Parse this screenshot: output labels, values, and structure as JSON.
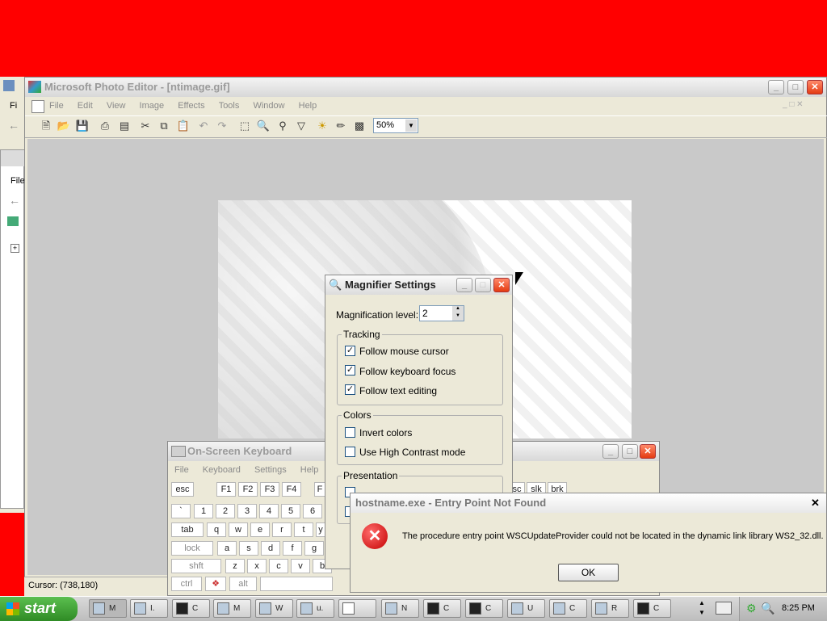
{
  "photo_editor": {
    "title": "Microsoft Photo Editor - [ntimage.gif]",
    "menu": [
      "File",
      "Edit",
      "View",
      "Image",
      "Effects",
      "Tools",
      "Window",
      "Help"
    ],
    "zoom": "50%",
    "status": "Cursor: (738,180)"
  },
  "behind_window": {
    "menu_fi": "Fi",
    "menu_file": "File"
  },
  "magnifier": {
    "title": "Magnifier Settings",
    "level_label": "Magnification level:",
    "level_value": "2",
    "tracking_label": "Tracking",
    "follow_mouse": "Follow mouse cursor",
    "follow_keyboard": "Follow keyboard focus",
    "follow_text": "Follow text editing",
    "colors_label": "Colors",
    "invert": "Invert colors",
    "high_contrast": "Use High Contrast mode",
    "presentation_label": "Presentation"
  },
  "osk": {
    "title": "On-Screen Keyboard",
    "menu": [
      "File",
      "Keyboard",
      "Settings",
      "Help"
    ],
    "row0": [
      "esc",
      "F1",
      "F2",
      "F3",
      "F4",
      "F"
    ],
    "row0_right": [
      "sc",
      "slk",
      "brk"
    ],
    "row1": [
      "`",
      "1",
      "2",
      "3",
      "4",
      "5",
      "6"
    ],
    "row2": [
      "tab",
      "q",
      "w",
      "e",
      "r",
      "t",
      "y"
    ],
    "row3": [
      "lock",
      "a",
      "s",
      "d",
      "f",
      "g"
    ],
    "row4": [
      "shft",
      "z",
      "x",
      "c",
      "v",
      "b"
    ],
    "row5": [
      "ctrl",
      "alt"
    ]
  },
  "error_dialog": {
    "title": "hostname.exe - Entry Point Not Found",
    "message": "The procedure entry point WSCUpdateProvider could not be located in the dynamic link library WS2_32.dll.",
    "ok": "OK"
  },
  "taskbar": {
    "start": "start",
    "items": [
      "M",
      "I.",
      "C",
      "M",
      "W",
      "u.",
      "",
      "N",
      "C",
      "C",
      "U",
      "C",
      "R",
      "C"
    ],
    "clock": "8:25 PM"
  }
}
